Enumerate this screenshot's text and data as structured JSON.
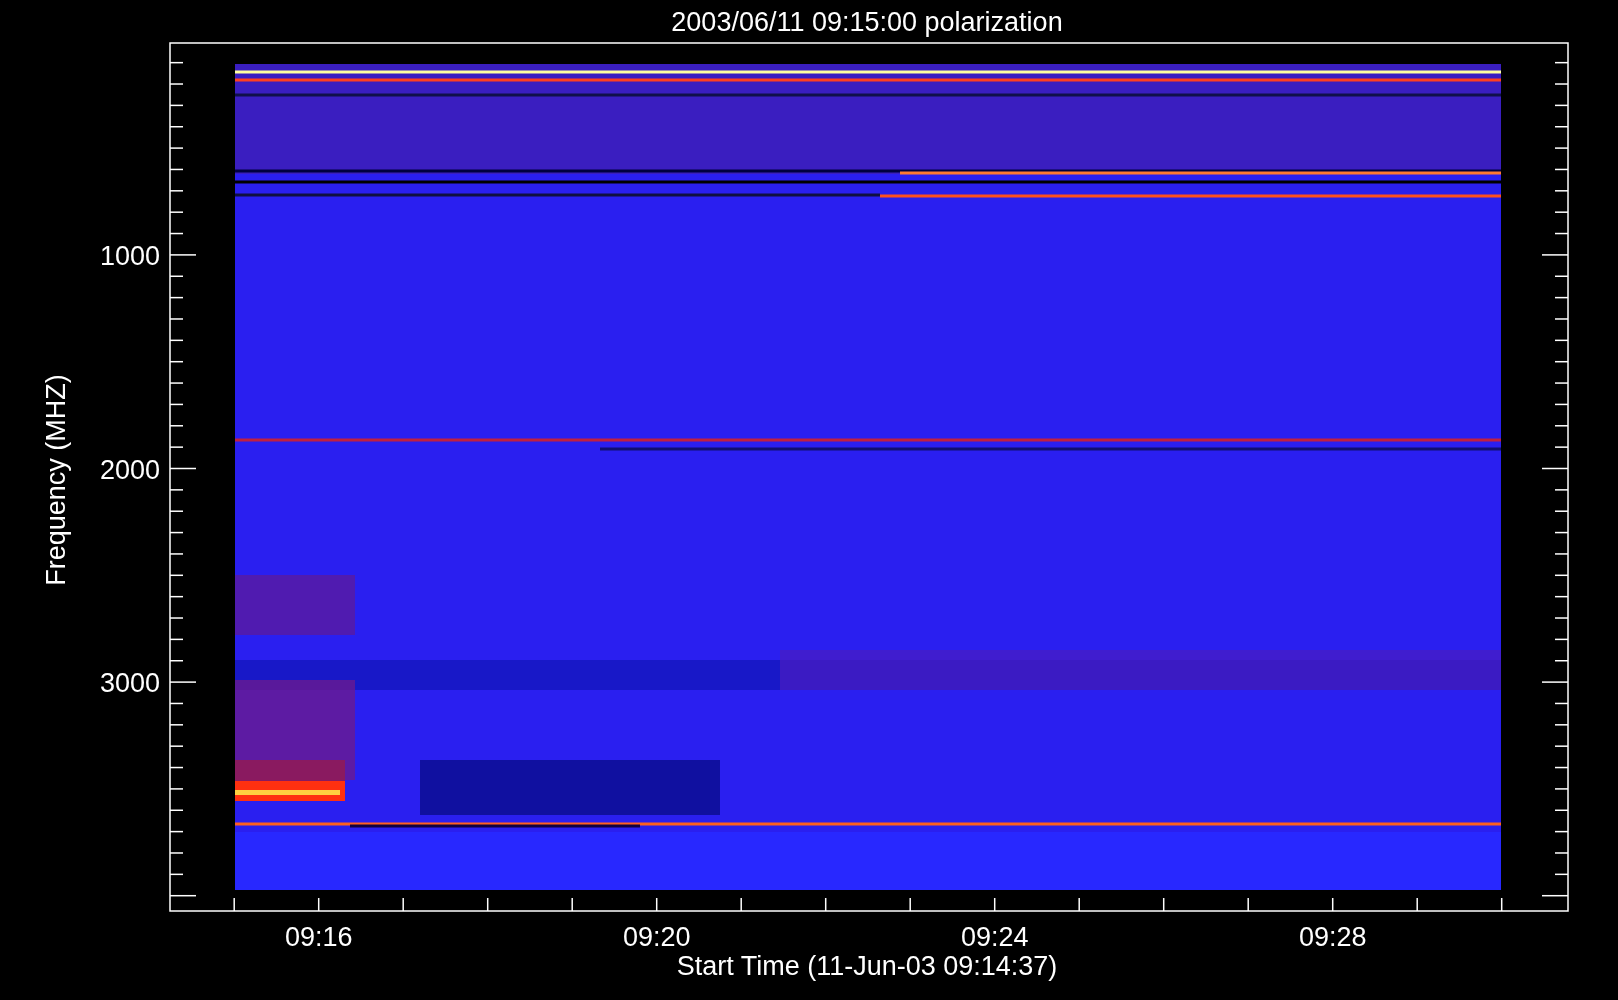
{
  "plot": {
    "title": "2003/06/11 09:15:00 polarization",
    "ylabel": "Frequency (MHZ)",
    "xlabel": "Start Time (11-Jun-03 09:14:37)",
    "yticks": [
      "1000",
      "2000",
      "3000"
    ],
    "xticks": [
      "09:16",
      "09:20",
      "09:24",
      "09:28"
    ]
  }
}
